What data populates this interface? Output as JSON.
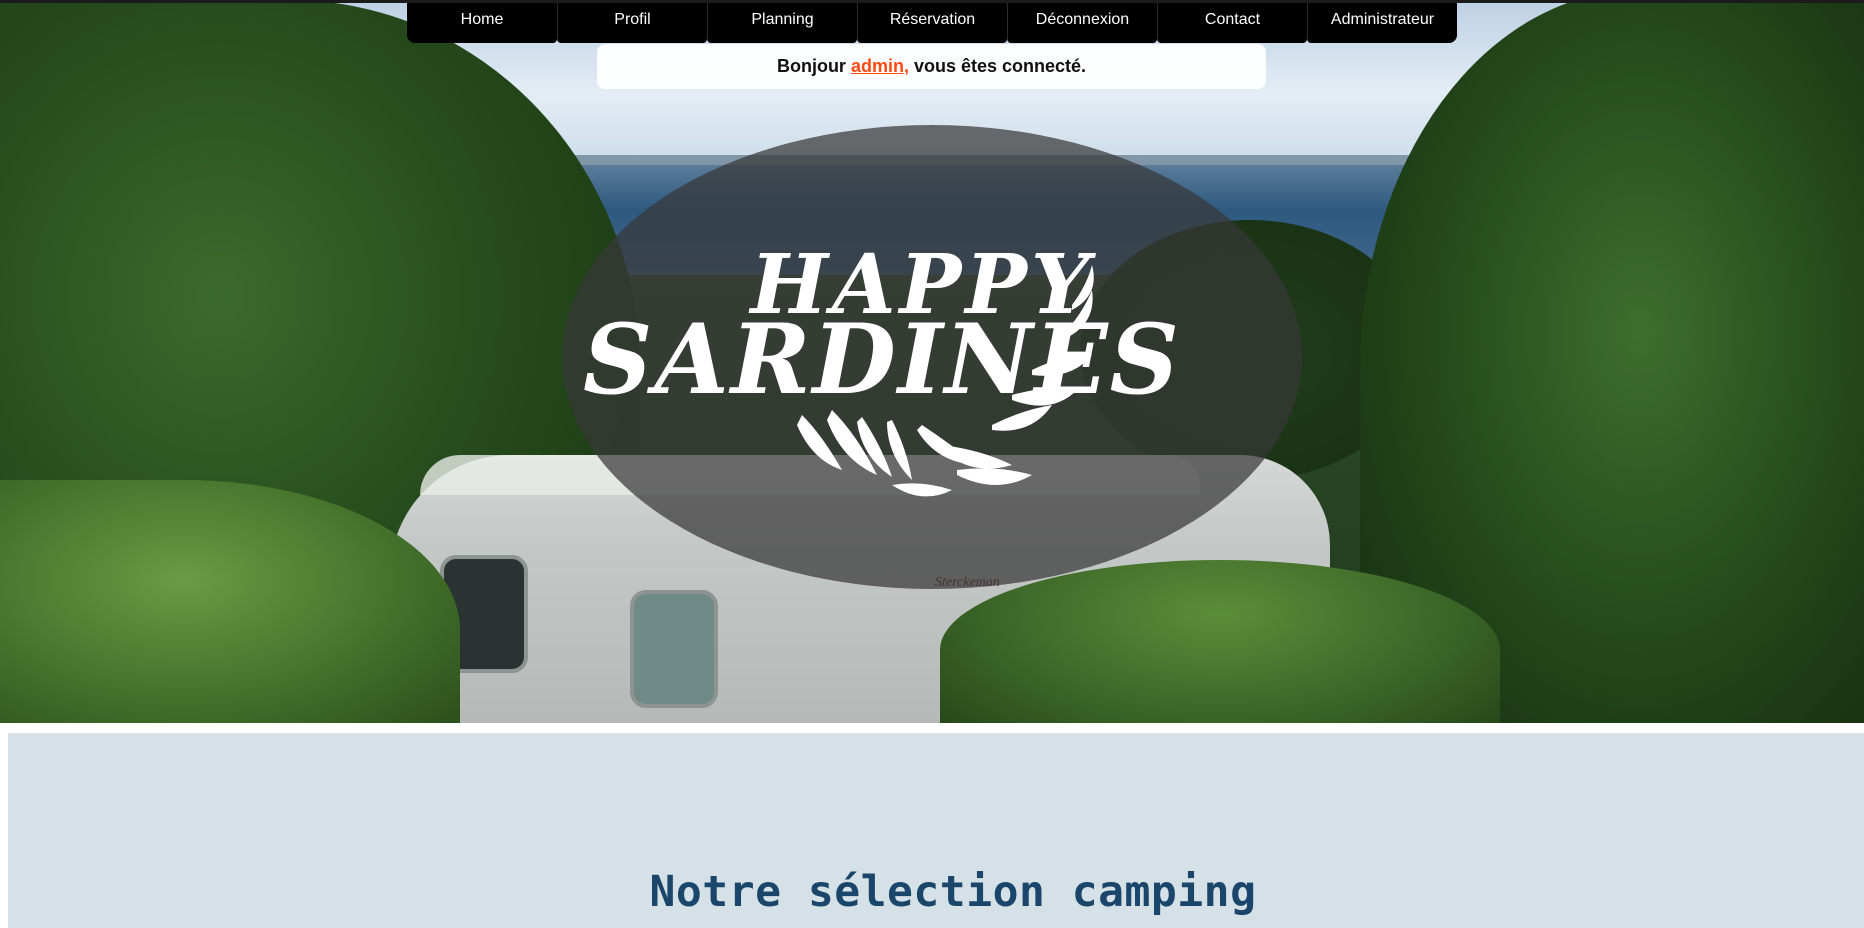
{
  "nav": {
    "items": [
      {
        "label": "Home"
      },
      {
        "label": "Profil"
      },
      {
        "label": "Planning"
      },
      {
        "label": "Réservation"
      },
      {
        "label": "Déconnexion"
      },
      {
        "label": "Contact"
      },
      {
        "label": "Administrateur"
      }
    ]
  },
  "greeting": {
    "prefix": "Bonjour ",
    "username": "admin,",
    "suffix": " vous êtes connecté."
  },
  "logo": {
    "line1": "HAPPY",
    "line2": "SARDINES"
  },
  "caravan_brand": "Sterckeman",
  "section": {
    "title": "Notre sélection camping"
  },
  "colors": {
    "nav_bg": "#000000",
    "link_accent": "#ff4b12",
    "section_bg": "#d5e1e6",
    "section_title": "#1b466b"
  }
}
